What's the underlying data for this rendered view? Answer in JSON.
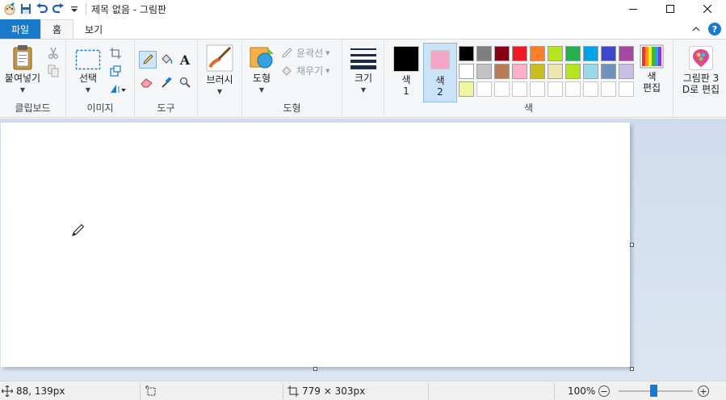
{
  "window": {
    "title": "제목 없음 - 그림판"
  },
  "tabs": {
    "file": "파일",
    "home": "홈",
    "view": "보기"
  },
  "clipboard": {
    "paste": "붙여넣기",
    "group": "클립보드"
  },
  "image": {
    "select": "선택",
    "group": "이미지"
  },
  "tools": {
    "group": "도구"
  },
  "brushes": {
    "label": "브러시"
  },
  "shapes": {
    "shapes_label": "도형",
    "outline": "윤곽선",
    "fill": "채우기",
    "group": "도형"
  },
  "size": {
    "label": "크기"
  },
  "colors": {
    "color1_line1": "색",
    "color1_line2": "1",
    "color2_line1": "색",
    "color2_line2": "2",
    "color1_value": "#000000",
    "color2_value": "#f4a7c4",
    "edit_colors_line1": "색",
    "edit_colors_line2": "편집",
    "group": "색",
    "palette_row1": [
      "#000000",
      "#7f7f7f",
      "#880015",
      "#ed1c24",
      "#ff7f27",
      "#b5e61d",
      "#22b14c",
      "#00a2e8",
      "#3f48cc",
      "#a349a4"
    ],
    "palette_row2": [
      "#ffffff",
      "#c3c3c3",
      "#b97a57",
      "#ffaec9",
      "#c8bf1d",
      "#efe4b0",
      "#b5e61d",
      "#99d9ea",
      "#7092be",
      "#c8bfe7"
    ],
    "palette_row3": [
      "#eff7a0",
      "",
      "",
      "",
      "",
      "",
      "",
      "",
      "",
      ""
    ]
  },
  "paint3d": {
    "line1": "그림판 3",
    "line2": "D로 편집"
  },
  "status": {
    "cursor_pos": "88, 139px",
    "canvas_size": "779 × 303px",
    "zoom": "100%"
  }
}
